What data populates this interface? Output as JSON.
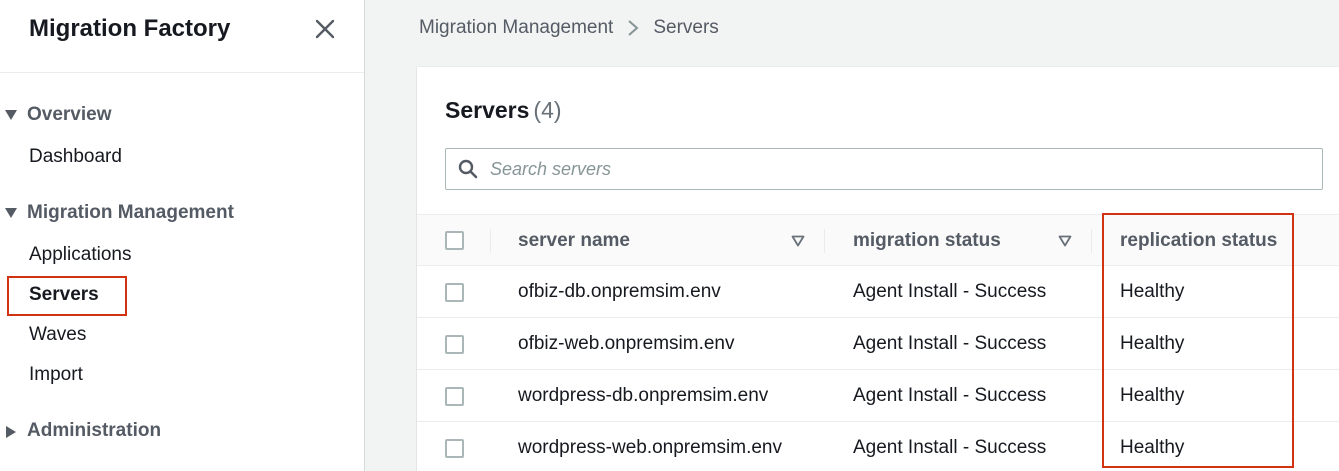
{
  "sidebar": {
    "title": "Migration Factory",
    "close_icon": "close-icon",
    "sections": [
      {
        "label": "Overview",
        "expanded": true,
        "items": [
          "Dashboard"
        ]
      },
      {
        "label": "Migration Management",
        "expanded": true,
        "items": [
          "Applications",
          "Servers",
          "Waves",
          "Import"
        ]
      },
      {
        "label": "Administration",
        "expanded": false,
        "items": []
      }
    ],
    "active_item": "Servers"
  },
  "breadcrumb": {
    "parent": "Migration Management",
    "current": "Servers"
  },
  "panel": {
    "title": "Servers",
    "count": "(4)",
    "search_placeholder": "Search servers",
    "columns": [
      "server name",
      "migration status",
      "replication status"
    ],
    "rows": [
      {
        "server_name": "ofbiz-db.onpremsim.env",
        "migration_status": "Agent Install - Success",
        "replication_status": "Healthy"
      },
      {
        "server_name": "ofbiz-web.onpremsim.env",
        "migration_status": "Agent Install - Success",
        "replication_status": "Healthy"
      },
      {
        "server_name": "wordpress-db.onpremsim.env",
        "migration_status": "Agent Install - Success",
        "replication_status": "Healthy"
      },
      {
        "server_name": "wordpress-web.onpremsim.env",
        "migration_status": "Agent Install - Success",
        "replication_status": "Healthy"
      }
    ]
  },
  "highlight_color": "#d13212"
}
